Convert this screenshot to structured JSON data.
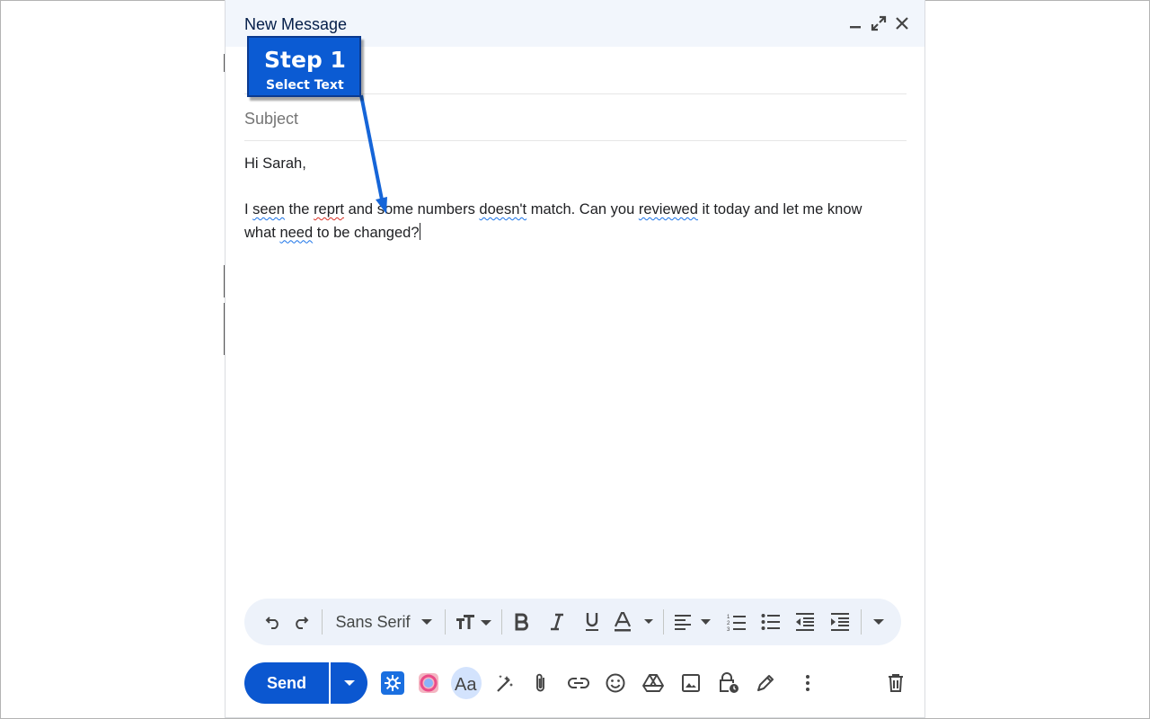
{
  "compose": {
    "title": "New Message",
    "subject_placeholder": "Subject",
    "body": {
      "greeting": "Hi Sarah,",
      "line1": {
        "w1": "I ",
        "e1": "seen",
        "w2": " the ",
        "e2": "reprt",
        "w3": " and some numbers ",
        "e3": "doesn't",
        "w4": " match. Can you ",
        "e4": "reviewed",
        "w5": " it today and let me know"
      },
      "line2": {
        "w1": "what ",
        "e1": "need",
        "w2": " to be changed?"
      }
    }
  },
  "formatting": {
    "font": "Sans Serif"
  },
  "actions": {
    "send_label": "Send"
  },
  "callout": {
    "title": "Step 1",
    "subtitle": "Select Text",
    "color": "#0b5bd3"
  },
  "colors": {
    "header_bg": "#f2f6fc",
    "accent": "#0b57d0",
    "toolbar_bg": "#edf2fa"
  }
}
